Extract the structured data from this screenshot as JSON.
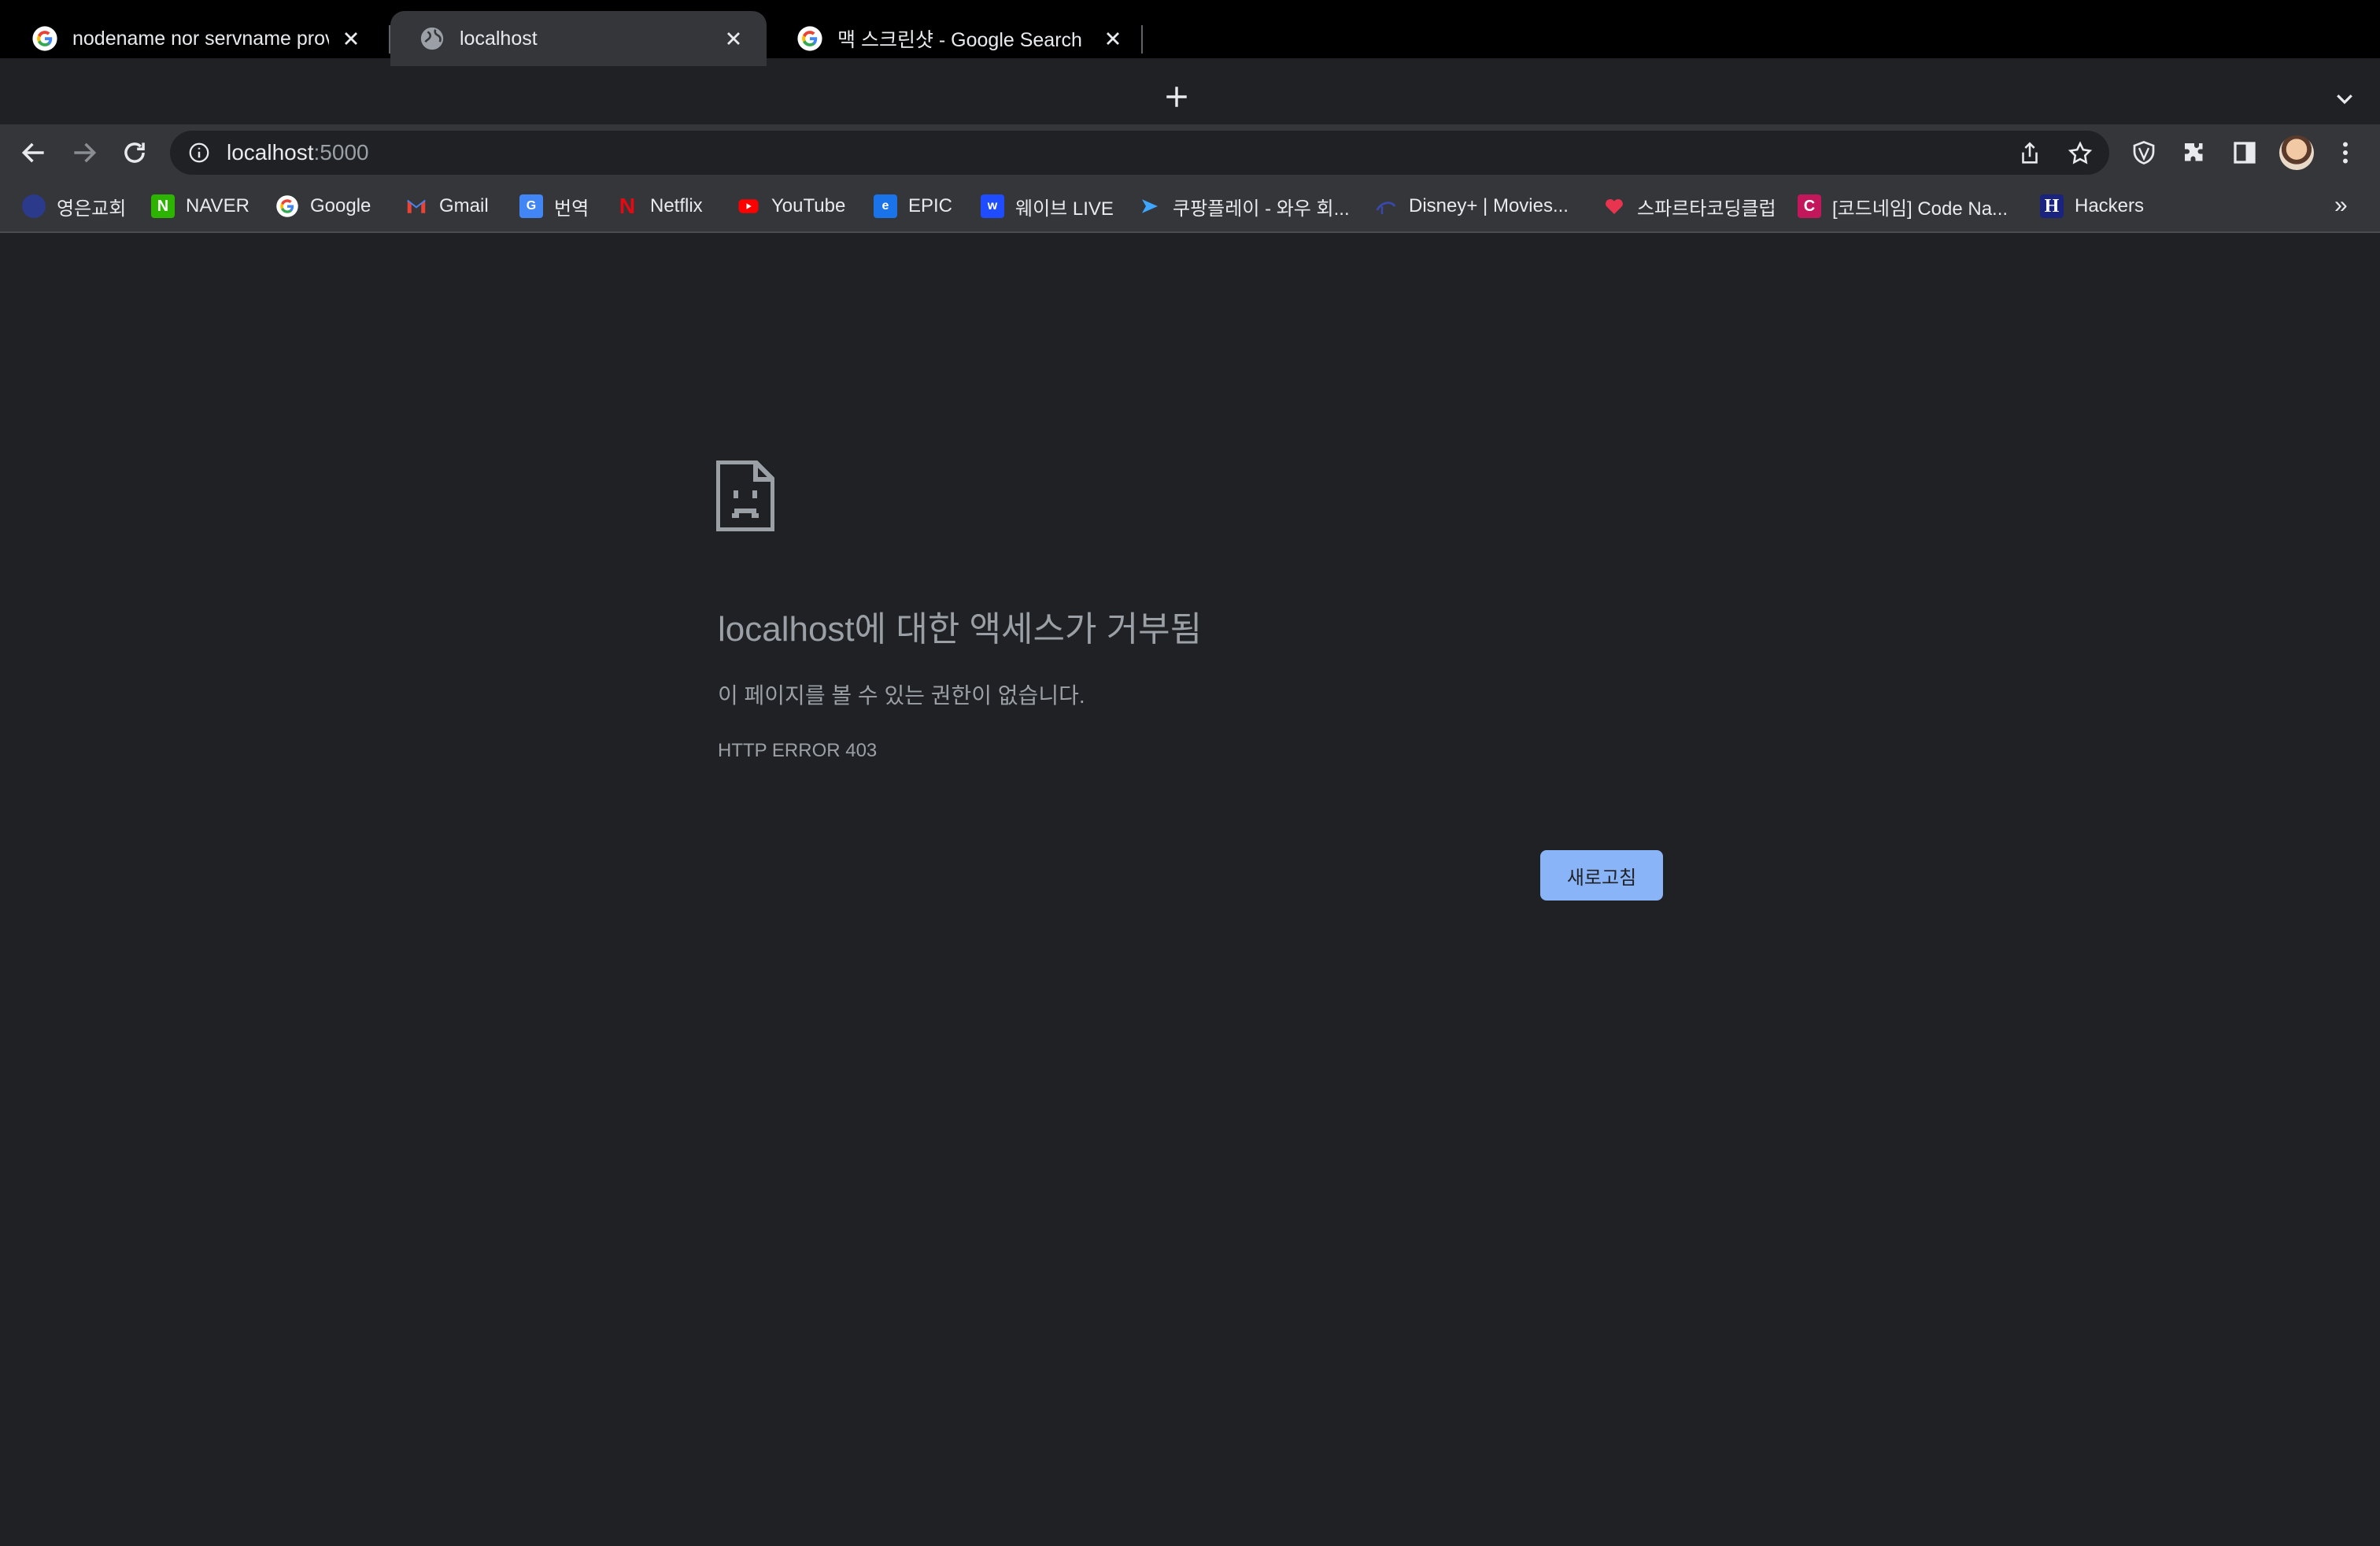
{
  "tabs": [
    {
      "title": "nodename nor servname provided",
      "favicon": "google-g-icon",
      "active": false
    },
    {
      "title": "localhost",
      "favicon": "globe-icon",
      "active": true
    },
    {
      "title": "맥 스크린샷 - Google Search",
      "favicon": "google-g-icon",
      "active": false
    }
  ],
  "address": {
    "host": "localhost",
    "port": ":5000"
  },
  "bookmarks": [
    {
      "label": "영은교회",
      "icon": "church-icon",
      "color": "#2b3a8a"
    },
    {
      "label": "NAVER",
      "icon": "naver-icon",
      "color": "#2db400"
    },
    {
      "label": "Google",
      "icon": "google-g-icon",
      "color": "#4285f4"
    },
    {
      "label": "Gmail",
      "icon": "gmail-icon",
      "color": "#ea4335"
    },
    {
      "label": "번역",
      "icon": "translate-icon",
      "color": "#4285f4"
    },
    {
      "label": "Netflix",
      "icon": "netflix-icon",
      "color": "#e50914"
    },
    {
      "label": "YouTube",
      "icon": "youtube-icon",
      "color": "#ff0000"
    },
    {
      "label": "EPIC",
      "icon": "epic-icon",
      "color": "#1a73e8"
    },
    {
      "label": "웨이브 LIVE",
      "icon": "wavve-icon",
      "color": "#1f4cff"
    },
    {
      "label": "쿠팡플레이 - 와우 회...",
      "icon": "coupang-play-icon",
      "color": "#3ea6ff"
    },
    {
      "label": "Disney+ | Movies...",
      "icon": "disney-icon",
      "color": "#1a237e"
    },
    {
      "label": "스파르타코딩클럽",
      "icon": "sparta-icon",
      "color": "#e8344e"
    },
    {
      "label": "[코드네임] Code Na...",
      "icon": "codename-icon",
      "color": "#c2185b"
    },
    {
      "label": "Hackers",
      "icon": "hackers-icon",
      "color": "#1a237e"
    }
  ],
  "bookmarks_more": "»",
  "error": {
    "title": "localhost에 대한 액세스가 거부됨",
    "description": "이 페이지를 볼 수 있는 권한이 없습니다.",
    "code": "HTTP ERROR 403",
    "reload_label": "새로고침"
  },
  "colors": {
    "background": "#202124",
    "toolbar": "#35363a",
    "accent": "#8ab4f8",
    "error_text": "#9aa0a6"
  }
}
